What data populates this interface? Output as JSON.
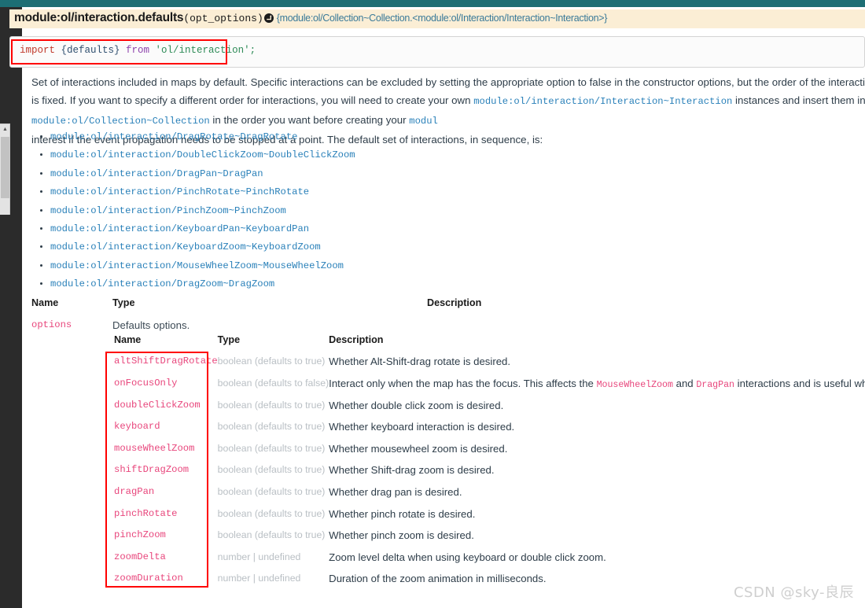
{
  "theme": {
    "top_strip_color": "#1d6e74",
    "sidebar_color": "#2b2b2b",
    "signature_bg": "#fbeed5",
    "link_color": "#2980b9",
    "param_color": "#e8467c",
    "highlight_color": "#ff0000"
  },
  "signature": {
    "name": "module:ol/interaction.defaults",
    "params": "(opt_options)",
    "arrow_icon": "returns-arrow-icon",
    "return_type": "{module:ol/Collection~Collection.<module:ol/Interaction/Interaction~Interaction>}"
  },
  "code_block": {
    "keyword": "import",
    "braced": " {defaults} ",
    "from": "from",
    "module": " 'ol/interaction';",
    "full_text": "import {defaults} from 'ol/interaction';"
  },
  "description": {
    "part1": "Set of interactions included in maps by default. Specific interactions can be excluded by setting the appropriate option to false in the constructor options, but the order of the interactions is fixed. If you want to specify a different order for interactions, you ",
    "part2": "will need to create your own ",
    "link1": "module:ol/interaction/Interaction~Interaction",
    "part3": " instances and insert them into a ",
    "link2": "module:ol/Collection~Collection",
    "part4": " in the order you want before creating your ",
    "link3": "modul",
    "part5": "interest if the event propagation needs to be stopped at a point. The default set of interactions, in sequence, is:"
  },
  "interaction_list": [
    "module:ol/interaction/DragRotate~DragRotate",
    "module:ol/interaction/DoubleClickZoom~DoubleClickZoom",
    "module:ol/interaction/DragPan~DragPan",
    "module:ol/interaction/PinchRotate~PinchRotate",
    "module:ol/interaction/PinchZoom~PinchZoom",
    "module:ol/interaction/KeyboardPan~KeyboardPan",
    "module:ol/interaction/KeyboardZoom~KeyboardZoom",
    "module:ol/interaction/MouseWheelZoom~MouseWheelZoom",
    "module:ol/interaction/DragZoom~DragZoom"
  ],
  "outer_table": {
    "headers": {
      "name": "Name",
      "type": "Type",
      "description": "Description"
    },
    "row": {
      "name": "options",
      "type": "Defaults options."
    }
  },
  "inner_table": {
    "headers": {
      "name": "Name",
      "type": "Type",
      "description": "Description"
    },
    "rows": [
      {
        "name": "altShiftDragRotate",
        "type": "boolean (defaults to true)",
        "desc": "Whether Alt-Shift-drag rotate is desired."
      },
      {
        "name": "onFocusOnly",
        "type": "boolean (defaults to false)",
        "desc_a": "Interact only when the map has the focus. This affects the ",
        "desc_link1": "MouseWheelZoom",
        "desc_b": " and ",
        "desc_link2": "DragPan",
        "desc_c": " interactions and is useful when page scroll is"
      },
      {
        "name": "doubleClickZoom",
        "type": "boolean (defaults to true)",
        "desc": "Whether double click zoom is desired."
      },
      {
        "name": "keyboard",
        "type": "boolean (defaults to true)",
        "desc": "Whether keyboard interaction is desired."
      },
      {
        "name": "mouseWheelZoom",
        "type": "boolean (defaults to true)",
        "desc": "Whether mousewheel zoom is desired."
      },
      {
        "name": "shiftDragZoom",
        "type": "boolean (defaults to true)",
        "desc": "Whether Shift-drag zoom is desired."
      },
      {
        "name": "dragPan",
        "type": "boolean (defaults to true)",
        "desc": "Whether drag pan is desired."
      },
      {
        "name": "pinchRotate",
        "type": "boolean (defaults to true)",
        "desc": "Whether pinch rotate is desired."
      },
      {
        "name": "pinchZoom",
        "type": "boolean (defaults to true)",
        "desc": "Whether pinch zoom is desired."
      },
      {
        "name": "zoomDelta",
        "type": "number | undefined",
        "desc": "Zoom level delta when using keyboard or double click zoom."
      },
      {
        "name": "zoomDuration",
        "type": "number | undefined",
        "desc": "Duration of the zoom animation in milliseconds."
      }
    ]
  },
  "watermark": "CSDN @sky-良辰"
}
